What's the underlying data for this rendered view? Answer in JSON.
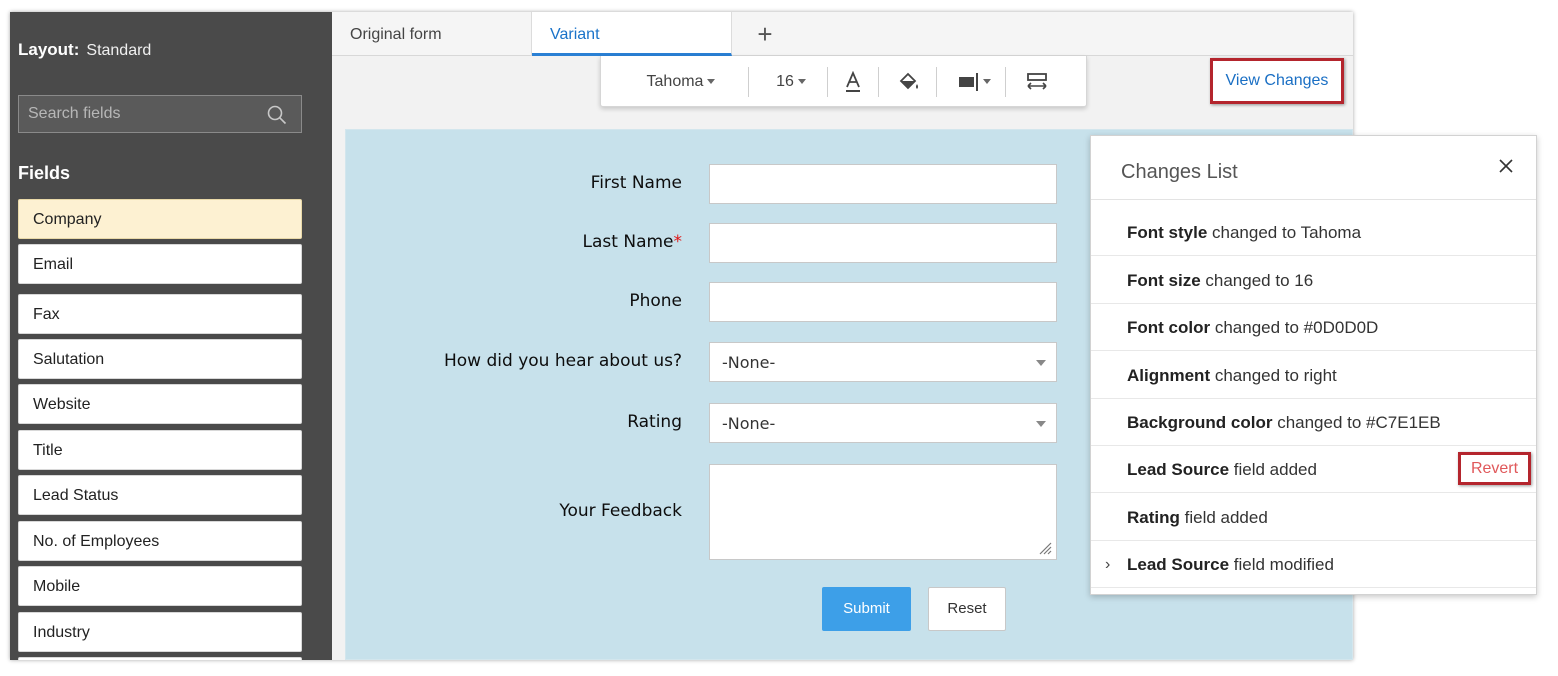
{
  "sidebar": {
    "layout_label": "Layout:",
    "layout_value": "Standard",
    "search_placeholder": "Search fields",
    "fields_title": "Fields",
    "fields": [
      "Company",
      "Email",
      "Fax",
      "Salutation",
      "Website",
      "Title",
      "Lead Status",
      "No. of Employees",
      "Mobile",
      "Industry"
    ]
  },
  "tabs": {
    "original": "Original form",
    "variant": "Variant",
    "add": "+"
  },
  "toolbar": {
    "font": "Tahoma",
    "size": "16"
  },
  "view_changes": "View Changes",
  "form": {
    "first_name": "First Name",
    "last_name": "Last Name",
    "required_mark": "*",
    "phone": "Phone",
    "hear": "How did you hear about us?",
    "hear_value": "-None-",
    "rating": "Rating",
    "rating_value": "-None-",
    "feedback": "Your Feedback",
    "submit": "Submit",
    "reset": "Reset"
  },
  "changes": {
    "title": "Changes List",
    "revert": "Revert",
    "items": [
      {
        "bold": "Font style",
        "rest": " changed to Tahoma"
      },
      {
        "bold": "Font size",
        "rest": " changed to 16"
      },
      {
        "bold": "Font color",
        "rest": " changed to #0D0D0D"
      },
      {
        "bold": "Alignment",
        "rest": " changed to right"
      },
      {
        "bold": "Background color",
        "rest": " changed to #C7E1EB"
      },
      {
        "bold": "Lead Source",
        "rest": " field added"
      },
      {
        "bold": "Rating",
        "rest": " field added"
      },
      {
        "bold": "Lead Source",
        "rest": " field modified"
      }
    ]
  },
  "colors": {
    "accent": "#2a80d4",
    "highlight": "#b4252d",
    "form_bg": "#C7E1EB",
    "font_color": "#0D0D0D"
  }
}
